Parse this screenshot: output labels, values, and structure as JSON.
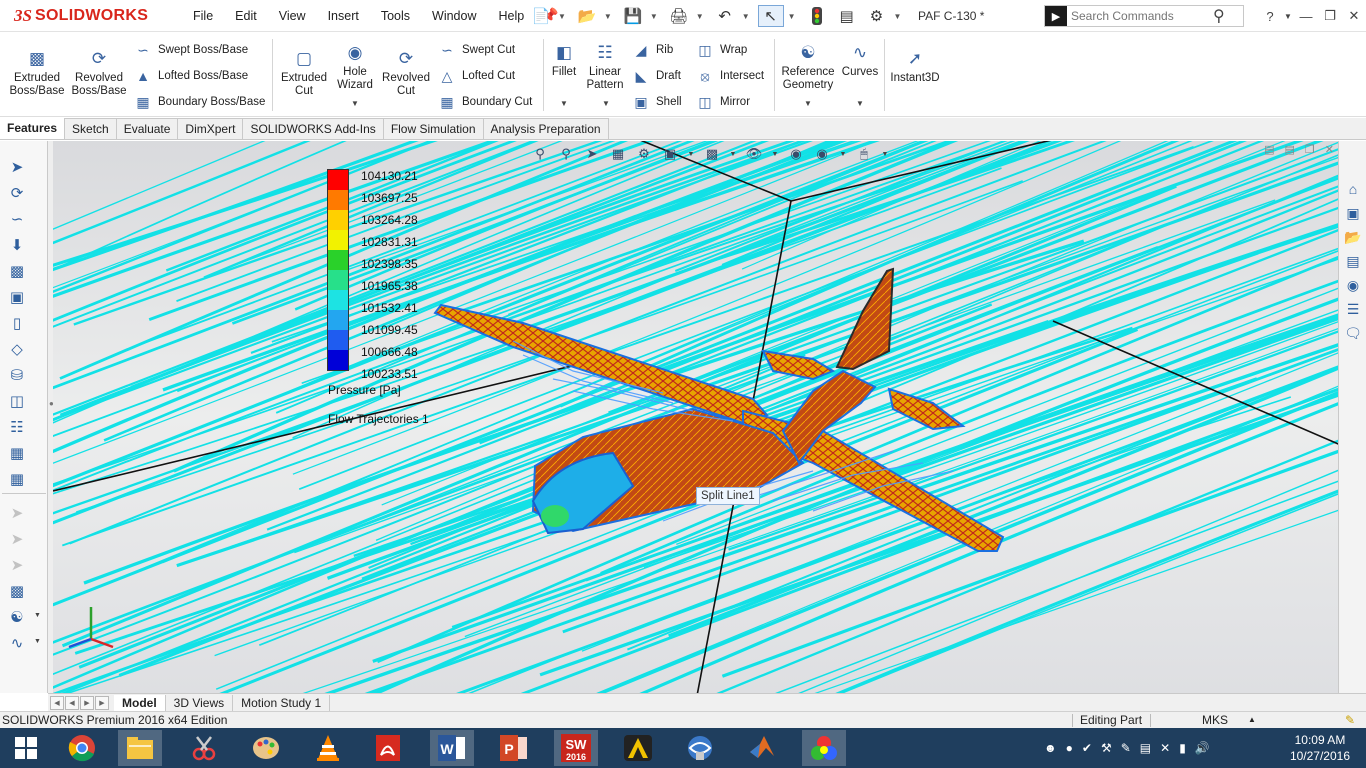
{
  "app": {
    "logo_prefix": "3S",
    "logo_name": "SOLIDWORKS",
    "document_title": "PAF C-130 *",
    "menus": [
      "File",
      "Edit",
      "View",
      "Insert",
      "Tools",
      "Window",
      "Help"
    ],
    "search_placeholder": "Search Commands"
  },
  "ribbon": {
    "extruded_boss": "Extruded Boss/Base",
    "revolved_boss": "Revolved Boss/Base",
    "swept_boss": "Swept Boss/Base",
    "lofted_boss": "Lofted Boss/Base",
    "boundary_boss": "Boundary Boss/Base",
    "extruded_cut": "Extruded Cut",
    "hole_wizard": "Hole Wizard",
    "revolved_cut": "Revolved Cut",
    "swept_cut": "Swept Cut",
    "lofted_cut": "Lofted Cut",
    "boundary_cut": "Boundary Cut",
    "fillet": "Fillet",
    "linear_pattern": "Linear Pattern",
    "rib": "Rib",
    "draft": "Draft",
    "shell": "Shell",
    "wrap": "Wrap",
    "intersect": "Intersect",
    "mirror": "Mirror",
    "reference_geometry": "Reference Geometry",
    "curves": "Curves",
    "instant3d": "Instant3D"
  },
  "tabs": [
    "Features",
    "Sketch",
    "Evaluate",
    "DimXpert",
    "SOLIDWORKS Add-Ins",
    "Flow Simulation",
    "Analysis Preparation"
  ],
  "legend": {
    "values": [
      "104130.21",
      "103697.25",
      "103264.28",
      "102831.31",
      "102398.35",
      "101965.38",
      "101532.41",
      "101099.45",
      "100666.48",
      "100233.51"
    ],
    "colors": [
      "#ff0000",
      "#ff7a00",
      "#ffd000",
      "#f2f200",
      "#2ad12a",
      "#27e08a",
      "#1de3e3",
      "#23a6f0",
      "#1f5cf0",
      "#0000d8"
    ],
    "title": "Pressure [Pa]",
    "plot_name": "Flow Trajectories 1"
  },
  "tooltip": "Split Line1",
  "bottom_tabs": [
    "Model",
    "3D Views",
    "Motion Study 1"
  ],
  "status": {
    "edition": "SOLIDWORKS Premium 2016 x64 Edition",
    "mode": "Editing Part",
    "units": "MKS"
  },
  "clock": {
    "time": "10:09 AM",
    "date": "10/27/2016"
  },
  "taskbar_apps": [
    "windows-start",
    "chrome",
    "file-explorer",
    "snipping-tool",
    "paint",
    "vlc",
    "acrobat",
    "word",
    "powerpoint",
    "solidworks-2016",
    "archicad",
    "network-tool",
    "matlab",
    "color-app"
  ],
  "sw_badge_year": "2016"
}
